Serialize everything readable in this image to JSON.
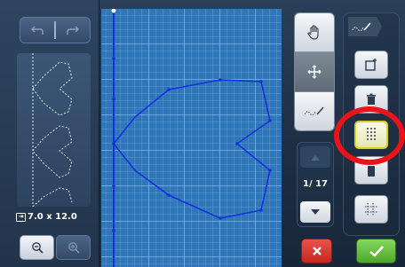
{
  "design": {
    "size_label": "7.0 x 12.0"
  },
  "pager": {
    "page_indicator": "1/ 17"
  },
  "icons": {
    "undo": "undo-icon",
    "redo": "redo-icon",
    "size": "size-icon",
    "zoom_out": "zoom-out-icon",
    "zoom_in": "zoom-in-icon",
    "hand": "hand-pan-icon",
    "move": "move-arrows-icon",
    "stitch": "stitch-line-icon",
    "up": "arrow-up-icon",
    "down": "arrow-down-icon",
    "cancel": "close-icon",
    "ok": "checkmark-icon",
    "tab": "stitch-tab-icon",
    "add_frame": "add-frame-icon",
    "delete": "trash-icon",
    "grid_dots": "dot-grid-icon",
    "fill": "fill-icon",
    "dotted_cross": "dotted-cross-icon"
  },
  "colors": {
    "highlight": "#e8141a",
    "selected_border": "#d9d21f",
    "stitch_line": "#1133dd",
    "cancel": "#d43a32",
    "ok": "#62c13a"
  }
}
